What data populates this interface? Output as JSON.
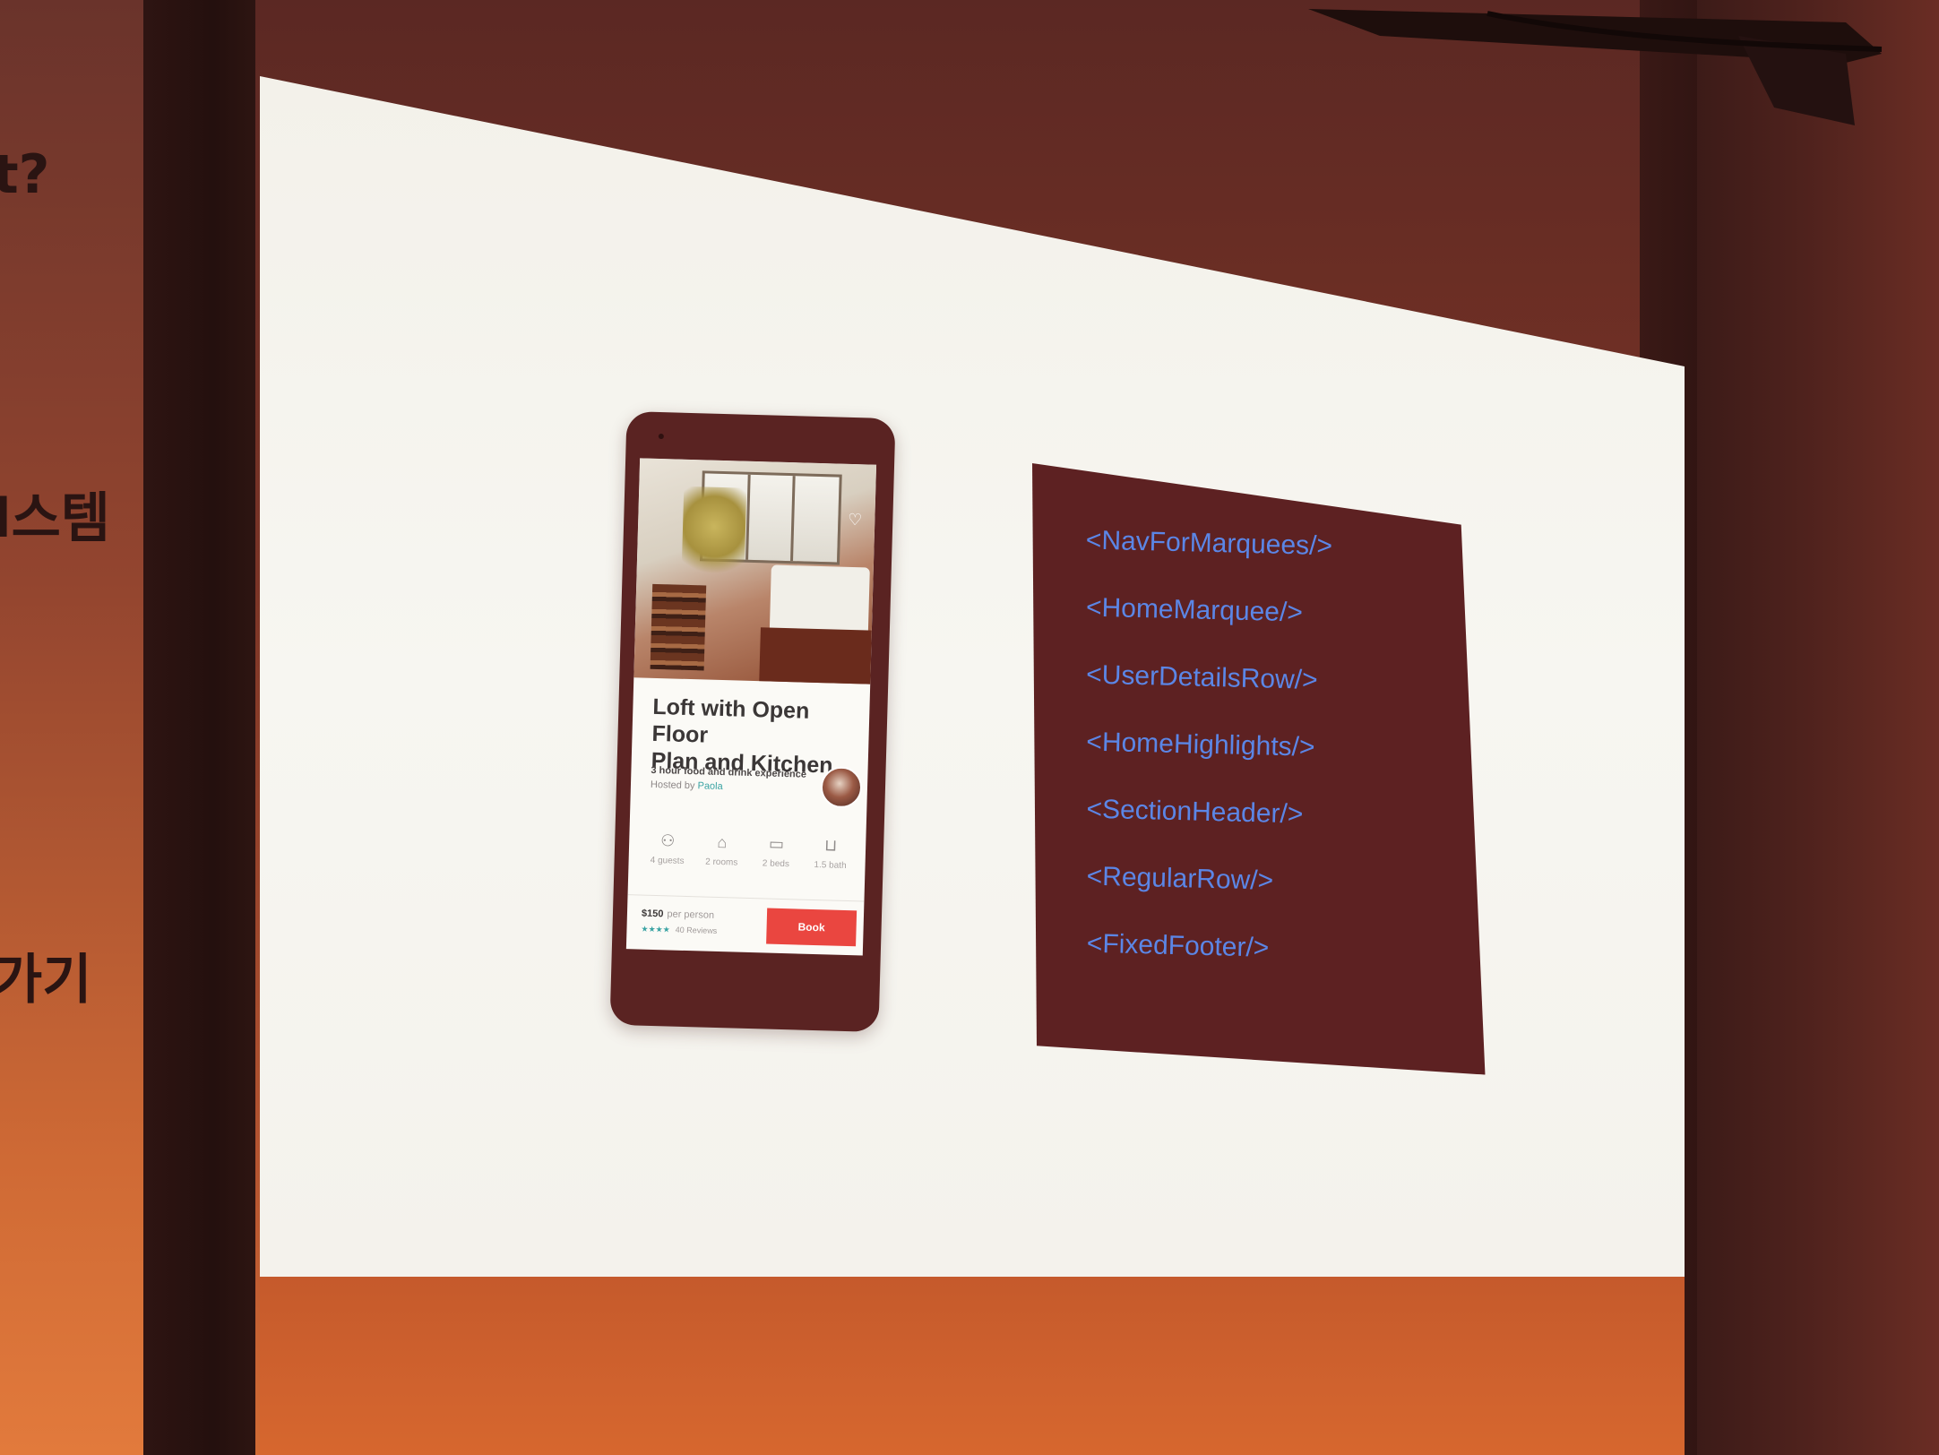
{
  "left_wall": {
    "lines": [
      "t?",
      "l스템",
      "가기"
    ]
  },
  "slide": {
    "phone": {
      "listing_title": "Loft with Open Floor\nPlan and Kitchen",
      "listing_subtitle": "3 hour food and drink experience",
      "hosted_by_label": "Hosted by",
      "host_name": "Paola",
      "amenities": [
        {
          "icon": "guests-icon",
          "label": "4 guests"
        },
        {
          "icon": "rooms-icon",
          "label": "2 rooms"
        },
        {
          "icon": "beds-icon",
          "label": "2 beds"
        },
        {
          "icon": "bath-icon",
          "label": "1.5 bath"
        }
      ],
      "price": "$150",
      "price_unit": "per person",
      "stars": "★★★★",
      "reviews": "40 Reviews",
      "book_label": "Book"
    },
    "code_lines": [
      "<NavForMarquees/>",
      "<HomeMarquee/>",
      "<UserDetailsRow/>",
      "<HomeHighlights/>",
      "<SectionHeader/>",
      "<RegularRow/>",
      "<FixedFooter/>"
    ],
    "colors": {
      "code_text": "#5b86e6",
      "code_panel": "#5d2122",
      "book_button": "#ea4640",
      "slide_background": "#f5f3ee"
    }
  }
}
